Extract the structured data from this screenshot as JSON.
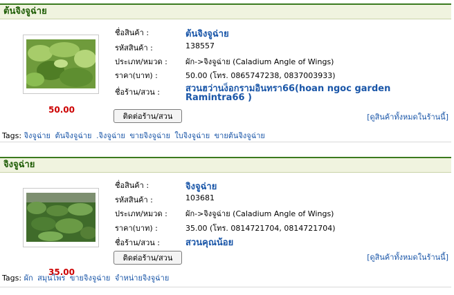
{
  "listings": [
    {
      "header": "ต้นจิงจูฉ่าย",
      "price_display": "50.00",
      "labels": {
        "name": "ชื่อสินค้า :",
        "code": "รหัสสินค้า :",
        "category": "ประเภท/หมวด :",
        "price": "ราคา(บาท) :",
        "shop": "ชื่อร้าน/สวน :"
      },
      "name": "ต้นจิงจูฉ่าย",
      "code": "138557",
      "category": "ผัก->จิงจูฉ่าย (Caladium Angle of Wings)",
      "price": "50.00 (โทร. 0865747238, 0837003933)",
      "shop_line1": "สวนฮว่านง็อกรามอินทรา66(hoan ngoc garden",
      "shop_line2": "Ramintra66 )",
      "contact_button": "ติดต่อร้าน/สวน",
      "all_products_link": "[ดูสินค้าทั้งหมดในร้านนี้]",
      "tags_label": "Tags:",
      "tags": [
        "จิงจูฉ่าย",
        "ต้นจิงจูฉ่าย",
        ".จิงจูฉ่าย",
        "ขายจิงจูฉ่าย",
        "ใบจิงจูฉ่าย",
        "ขายต้นจิงจูฉ่าย"
      ]
    },
    {
      "header": "จิงจูฉ่าย",
      "price_display": "35.00",
      "labels": {
        "name": "ชื่อสินค้า :",
        "code": "รหัสสินค้า :",
        "category": "ประเภท/หมวด :",
        "price": "ราคา(บาท) :",
        "shop": "ชื่อร้าน/สวน :"
      },
      "name": "จิงจูฉ่าย",
      "code": "103681",
      "category": "ผัก->จิงจูฉ่าย (Caladium Angle of Wings)",
      "price": "35.00 (โทร. 0814721704, 0814721704)",
      "shop_line1": "สวนคุณน้อย",
      "contact_button": "ติดต่อร้าน/สวน",
      "all_products_link": "[ดูสินค้าทั้งหมดในร้านนี้]",
      "tags_label": "Tags:",
      "tags": [
        "ผัก",
        "สมุนไพร",
        "ขายจิงจูฉ่าย",
        "จำหน่ายจิงจูฉ่าย"
      ]
    }
  ],
  "colors": {
    "header_text": "#1f5d06",
    "header_bg": "#f0f3df",
    "link": "#1a56a8",
    "price": "#cc0000"
  }
}
